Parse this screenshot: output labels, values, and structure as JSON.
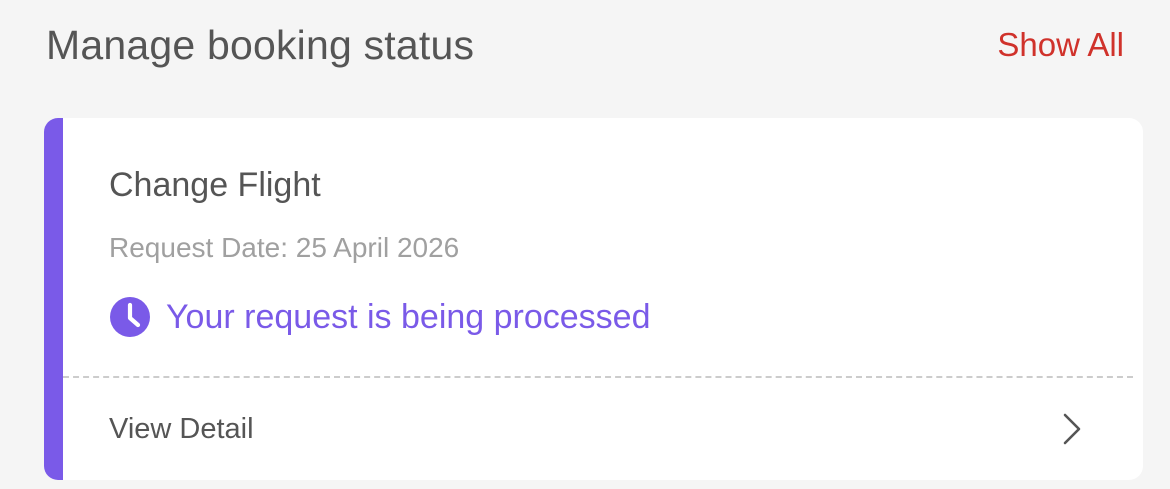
{
  "header": {
    "title": "Manage booking status",
    "show_all_label": "Show All"
  },
  "booking_card": {
    "title": "Change Flight",
    "request_date": "Request Date: 25 April 2026",
    "status_icon": "clock-icon",
    "status_text": "Your request is being processed",
    "view_detail_label": "View Detail",
    "chevron_icon": "chevron-right-icon"
  },
  "colors": {
    "accent": "#7a5ae8",
    "link": "#d0322b",
    "background": "#f5f5f5",
    "card": "#ffffff"
  }
}
